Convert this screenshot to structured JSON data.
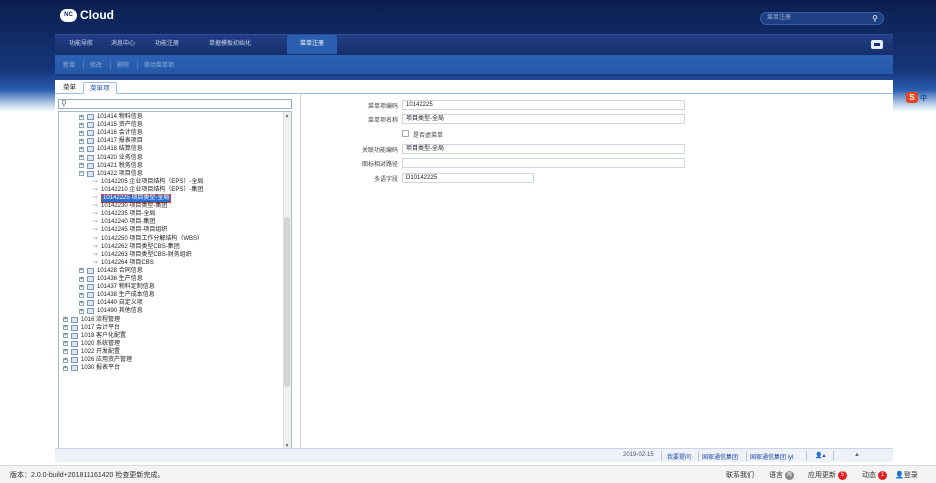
{
  "app": {
    "logo_badge": "NC",
    "logo_text": "Cloud",
    "search_placeholder": "菜单注册"
  },
  "nav": {
    "tabs": [
      {
        "label": "功能导航"
      },
      {
        "label": "消息中心"
      },
      {
        "label": "功能注册"
      },
      {
        "label": "单据模板初始化"
      },
      {
        "label": "菜单注册",
        "active": true
      }
    ]
  },
  "toolbar": {
    "buttons": [
      "新增",
      "修改",
      "删除",
      "移动菜单项"
    ]
  },
  "subtabs": [
    "菜单",
    "菜单项"
  ],
  "tree": {
    "rows": [
      {
        "code": "101414 物料信息",
        "kind": "folder",
        "indent": 1
      },
      {
        "code": "101415 资产信息",
        "kind": "folder",
        "indent": 1
      },
      {
        "code": "101416 会计信息",
        "kind": "folder",
        "indent": 1
      },
      {
        "code": "101417 报表项目",
        "kind": "folder",
        "indent": 1
      },
      {
        "code": "101418 结算信息",
        "kind": "folder",
        "indent": 1
      },
      {
        "code": "101420 业务信息",
        "kind": "folder",
        "indent": 1
      },
      {
        "code": "101421 税务信息",
        "kind": "folder",
        "indent": 1
      },
      {
        "code": "101422 项目信息",
        "kind": "folder-open",
        "indent": 1
      },
      {
        "code": "10142205 企业项目结构（EPS）-全局",
        "kind": "leaf",
        "indent": 2
      },
      {
        "code": "10142210 企业项目结构（EPS）-集团",
        "kind": "leaf",
        "indent": 2
      },
      {
        "code": "10142225 项目类型-全局",
        "kind": "leaf",
        "indent": 2,
        "selected": true
      },
      {
        "code": "10142230 项目类型-集团",
        "kind": "leaf",
        "indent": 2
      },
      {
        "code": "10142235 项目-全局",
        "kind": "leaf",
        "indent": 2
      },
      {
        "code": "10142240 项目-集团",
        "kind": "leaf",
        "indent": 2
      },
      {
        "code": "10142245 项目-项目组织",
        "kind": "leaf",
        "indent": 2
      },
      {
        "code": "10142250 项目工作分解结构（WBS）",
        "kind": "leaf",
        "indent": 2
      },
      {
        "code": "10142262 项目类型CBS-集团",
        "kind": "leaf",
        "indent": 2
      },
      {
        "code": "10142263 项目类型CBS-财务组织",
        "kind": "leaf",
        "indent": 2
      },
      {
        "code": "10142264 项目CBS",
        "kind": "leaf",
        "indent": 2
      },
      {
        "code": "101428 合同信息",
        "kind": "folder",
        "indent": 1
      },
      {
        "code": "101436 生产信息",
        "kind": "folder",
        "indent": 1
      },
      {
        "code": "101437 物料定制信息",
        "kind": "folder",
        "indent": 1
      },
      {
        "code": "101438 生产成本信息",
        "kind": "folder",
        "indent": 1
      },
      {
        "code": "101440 自定义项",
        "kind": "folder",
        "indent": 1
      },
      {
        "code": "101490 其他信息",
        "kind": "folder",
        "indent": 1
      },
      {
        "code": "1016 流程管理",
        "kind": "folder",
        "indent": 0
      },
      {
        "code": "1017 会计平台",
        "kind": "folder",
        "indent": 0
      },
      {
        "code": "1018 客户化配置",
        "kind": "folder",
        "indent": 0
      },
      {
        "code": "1020 系统管理",
        "kind": "folder",
        "indent": 0
      },
      {
        "code": "1022 开发配置",
        "kind": "folder",
        "indent": 0
      },
      {
        "code": "1026 应用资产管理",
        "kind": "folder",
        "indent": 0
      },
      {
        "code": "1030 报表平台",
        "kind": "folder",
        "indent": 0
      }
    ]
  },
  "form": {
    "fields": [
      {
        "label": "菜单项编码",
        "value": "10142225"
      },
      {
        "label": "菜单项名称",
        "value": "项目类型-全局"
      },
      {
        "label": "是否虚菜单",
        "value": "",
        "type": "checkbox"
      },
      {
        "label": "关联功能编码",
        "value": "项目类型-全局"
      },
      {
        "label": "图标相对路径",
        "value": ""
      },
      {
        "label": "多语字段",
        "value": "D10142225"
      }
    ]
  },
  "bottom_bar": {
    "date": "2019-02-15",
    "items": [
      "我要提问",
      "国家通信集团",
      "国家通信集团 lyl"
    ],
    "user_icon": "user-icon",
    "arrow_up": "▲"
  },
  "status_bar": {
    "version": "版本：2.0.0-build+201811161420  检查更新完成。",
    "contact": "联系我们",
    "language": "语言",
    "language_badge": "简",
    "app_update": "应用更新",
    "app_update_count": "5",
    "dynamics": "动态",
    "dynamics_count": "1",
    "login": "登录"
  },
  "side_badge": {
    "s": "S",
    "label": "中"
  }
}
